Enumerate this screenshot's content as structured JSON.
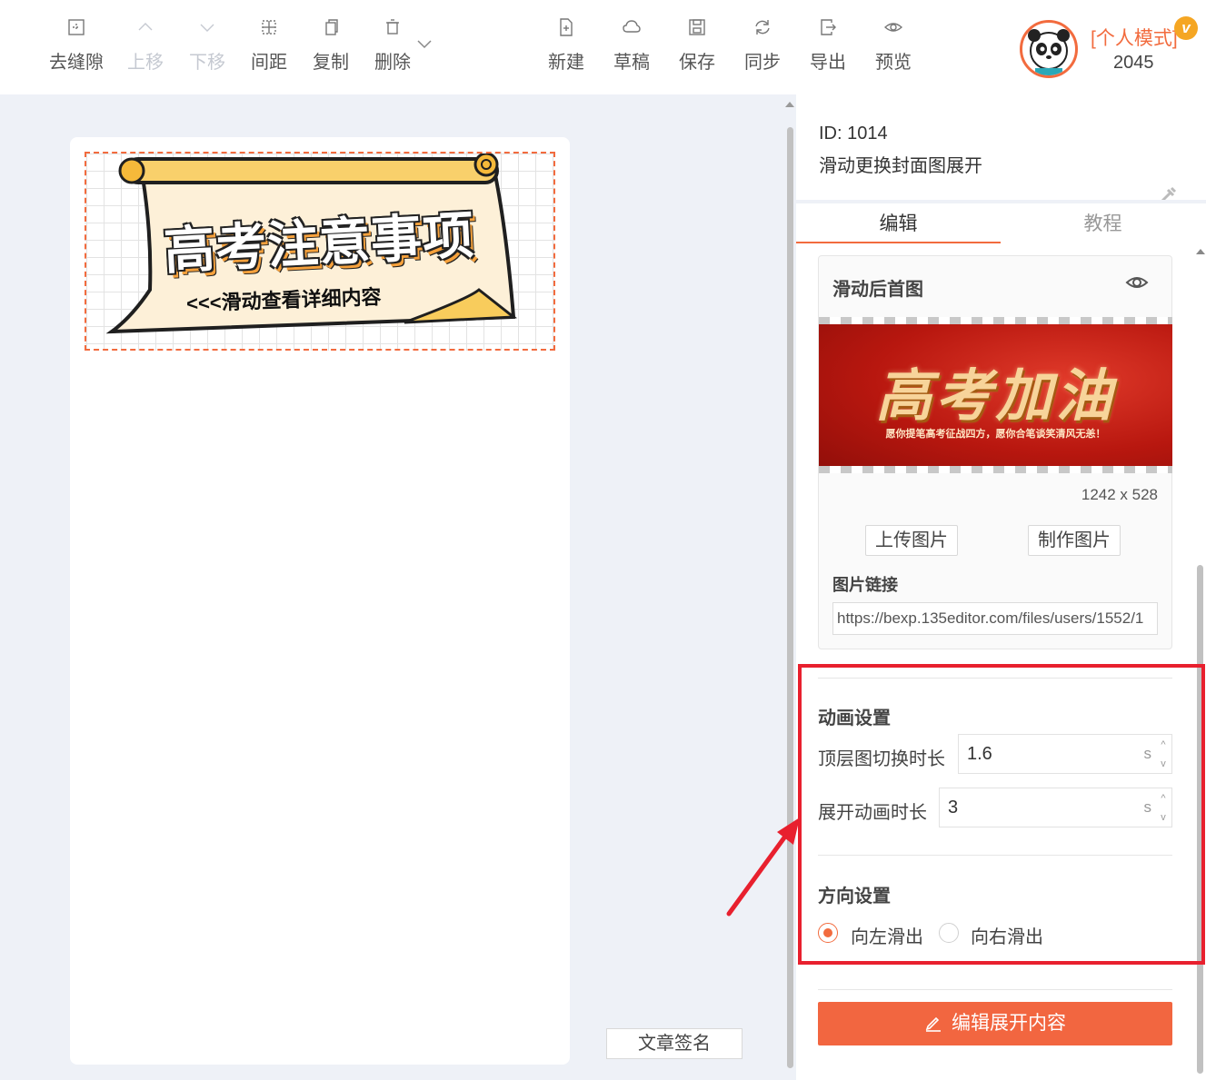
{
  "toolbar": {
    "left_items": [
      {
        "label": "去缝隙",
        "icon": "gap-icon",
        "enabled": true
      },
      {
        "label": "上移",
        "icon": "chevron-up-icon",
        "enabled": false
      },
      {
        "label": "下移",
        "icon": "chevron-down-icon",
        "enabled": false
      },
      {
        "label": "间距",
        "icon": "spacing-icon",
        "enabled": true
      },
      {
        "label": "复制",
        "icon": "copy-icon",
        "enabled": true
      },
      {
        "label": "删除",
        "icon": "trash-icon",
        "enabled": true
      }
    ],
    "right_items": [
      {
        "label": "新建",
        "icon": "new-file-icon"
      },
      {
        "label": "草稿",
        "icon": "cloud-icon"
      },
      {
        "label": "保存",
        "icon": "save-icon"
      },
      {
        "label": "同步",
        "icon": "sync-icon"
      },
      {
        "label": "导出",
        "icon": "export-icon"
      },
      {
        "label": "预览",
        "icon": "eye-icon"
      }
    ]
  },
  "user": {
    "mode": "[个人模式]",
    "badge": "v",
    "number": "2045"
  },
  "canvas": {
    "banner_title": "高考注意事项",
    "banner_subtitle": "<<<滑动查看详细内容",
    "sign_button": "文章签名"
  },
  "panel": {
    "id_text": "ID: 1014",
    "template_name": "滑动更换封面图展开",
    "tabs": [
      {
        "label": "编辑",
        "active": true
      },
      {
        "label": "教程",
        "active": false
      }
    ],
    "image_card": {
      "title": "滑动后首图",
      "preview_title": "高考加油",
      "preview_subtitle": "愿你提笔高考征战四方，愿你合笔谈笑清风无恙！",
      "size": "1242 x 528",
      "upload_button": "上传图片",
      "make_button": "制作图片",
      "link_label": "图片链接",
      "link_value": "https://bexp.135editor.com/files/users/1552/1"
    },
    "animation": {
      "title": "动画设置",
      "top_switch_label": "顶层图切换时长",
      "top_switch_value": "1.6",
      "expand_label": "展开动画时长",
      "expand_value": "3",
      "unit": "s",
      "step_up": "^",
      "step_down": "v"
    },
    "direction": {
      "title": "方向设置",
      "options": [
        {
          "label": "向左滑出",
          "selected": true
        },
        {
          "label": "向右滑出",
          "selected": false
        }
      ]
    },
    "cta_button": "编辑展开内容"
  },
  "colors": {
    "accent": "#f26b3e",
    "annotation_red": "#e8202e",
    "cta": "#f26640"
  }
}
